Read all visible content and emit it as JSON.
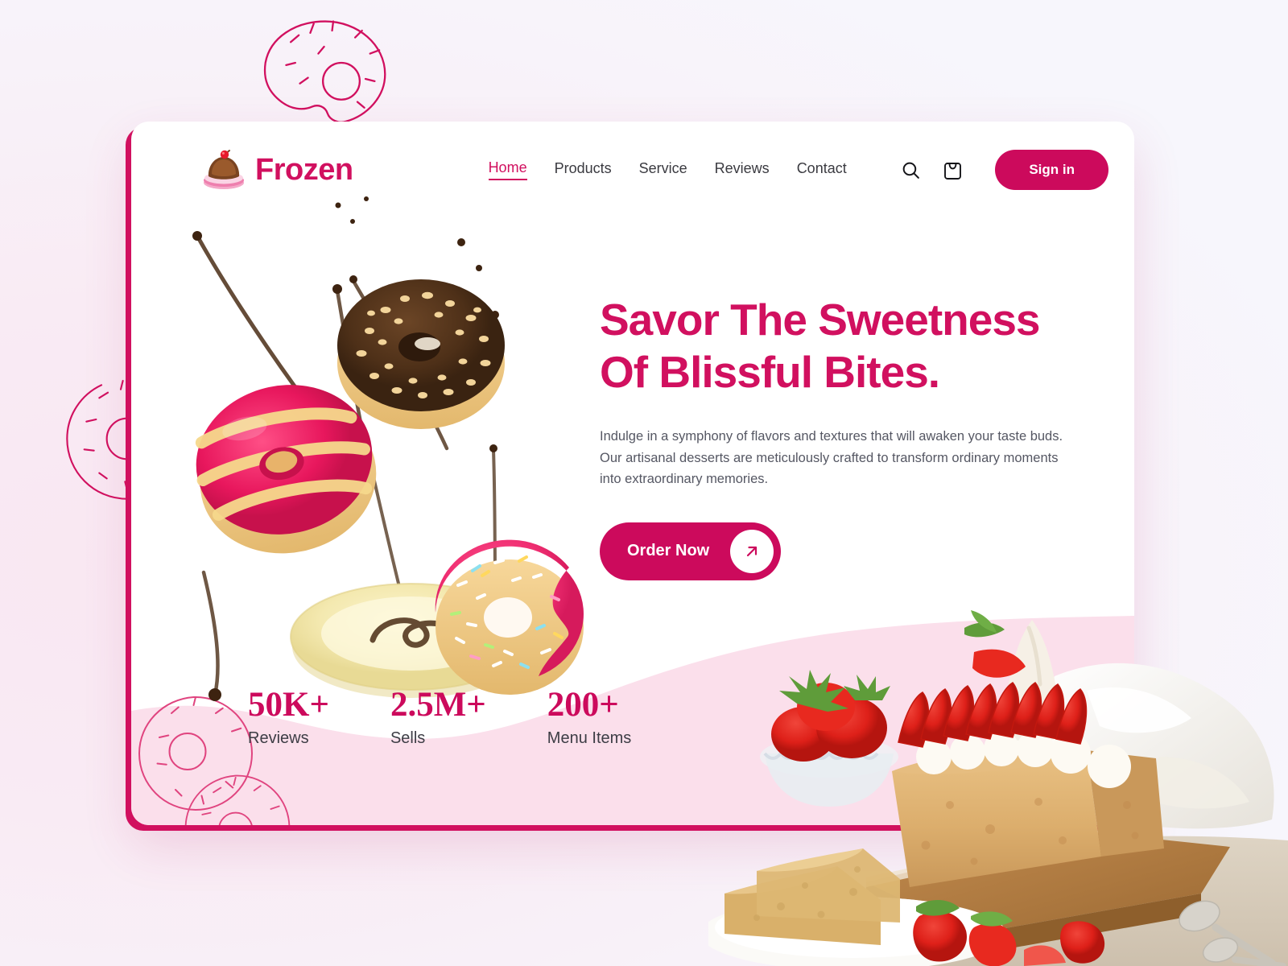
{
  "brand": {
    "name": "Frozen",
    "logo_icon": "chocolate-cupcake-cherry-icon",
    "color": "#d1105f"
  },
  "nav": {
    "items": [
      {
        "label": "Home",
        "active": true
      },
      {
        "label": "Products",
        "active": false
      },
      {
        "label": "Service",
        "active": false
      },
      {
        "label": "Reviews",
        "active": false
      },
      {
        "label": "Contact",
        "active": false
      }
    ]
  },
  "header_actions": {
    "search_icon": "search-icon",
    "cart_icon": "shopping-bag-icon",
    "signin_label": "Sign in"
  },
  "hero": {
    "headline_line1": "Savor The Sweetness",
    "headline_line2": "Of Blissful Bites.",
    "paragraph": "Indulge in a symphony of flavors and textures that will awaken your taste buds. Our artisanal desserts are meticulously crafted to transform ordinary moments into extraordinary memories.",
    "cta_label": "Order Now",
    "cta_icon": "arrow-up-right-icon"
  },
  "stats": [
    {
      "value": "50K+",
      "label": "Reviews"
    },
    {
      "value": "2.5M+",
      "label": "Sells"
    },
    {
      "value": "200+",
      "label": "Menu Items"
    }
  ],
  "decor": {
    "donut_outline_icon": "donut-outline-icon",
    "wave_color": "#fbdfeb",
    "accent_color": "#cc0a5c",
    "background_gradient": [
      "#f9e7f2",
      "#f7f6fc"
    ]
  }
}
